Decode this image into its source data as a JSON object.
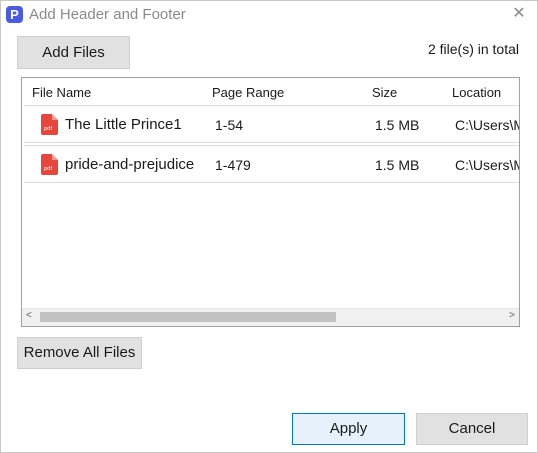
{
  "window": {
    "title": "Add Header and Footer",
    "app_icon_letter": "P",
    "close_symbol": "✕"
  },
  "toolbar": {
    "add_files_label": "Add Files",
    "file_count_text": "2 file(s) in total"
  },
  "table": {
    "columns": [
      "File Name",
      "Page Range",
      "Size",
      "Location"
    ],
    "rows": [
      {
        "name": "The Little Prince1",
        "page_range": "1-54",
        "size": "1.5 MB",
        "location": "C:\\Users\\M"
      },
      {
        "name": "pride-and-prejudice",
        "page_range": "1-479",
        "size": "1.5 MB",
        "location": "C:\\Users\\M"
      }
    ],
    "file_icon": "pdf-file-icon",
    "file_icon_label": "pdf"
  },
  "scrollbar": {
    "left_arrow": "<",
    "right_arrow": ">"
  },
  "actions": {
    "remove_all_label": "Remove All Files",
    "apply_label": "Apply",
    "cancel_label": "Cancel"
  },
  "colors": {
    "app_icon": "#4a5be0",
    "pdf_icon": "#e8453c",
    "primary_button_border": "#0078d7",
    "primary_button_bg": "#e5f1fb"
  }
}
